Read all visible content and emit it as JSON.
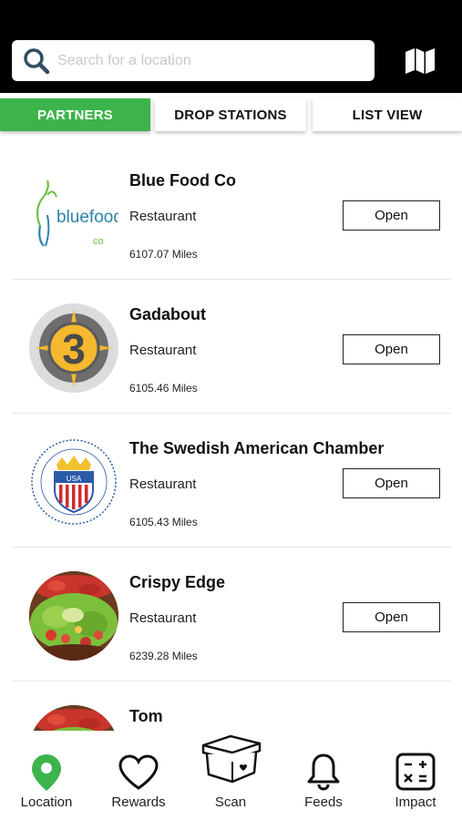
{
  "search": {
    "placeholder": "Search for a location",
    "value": ""
  },
  "header": {
    "map_icon": "map-icon",
    "search_icon": "search-icon"
  },
  "tabs": [
    {
      "label": "PARTNERS",
      "active": true
    },
    {
      "label": "DROP STATIONS",
      "active": false
    },
    {
      "label": "LIST VIEW",
      "active": false
    }
  ],
  "partners": [
    {
      "name": "Blue Food Co",
      "category": "Restaurant",
      "distance": "6107.07 Miles",
      "button": "Open",
      "logo_text": "bluefood",
      "logo_sub": "co"
    },
    {
      "name": "Gadabout",
      "category": "Restaurant",
      "distance": "6105.46 Miles",
      "button": "Open",
      "logo_text": "3"
    },
    {
      "name": "The Swedish American Chamber",
      "category": "Restaurant",
      "distance": "6105.43 Miles",
      "button": "Open",
      "logo_text": "USA"
    },
    {
      "name": "Crispy Edge",
      "category": "Restaurant",
      "distance": "6239.28 Miles",
      "button": "Open"
    },
    {
      "name": "Tom"
    }
  ],
  "nav": [
    {
      "label": "Location",
      "icon": "location-pin-icon",
      "active": true
    },
    {
      "label": "Rewards",
      "icon": "heart-icon",
      "active": false
    },
    {
      "label": "Scan",
      "icon": "container-icon",
      "active": false
    },
    {
      "label": "Feeds",
      "icon": "bell-icon",
      "active": false
    },
    {
      "label": "Impact",
      "icon": "calculator-icon",
      "active": false
    }
  ],
  "colors": {
    "accent": "#3cb44b",
    "topbar": "#000000"
  }
}
